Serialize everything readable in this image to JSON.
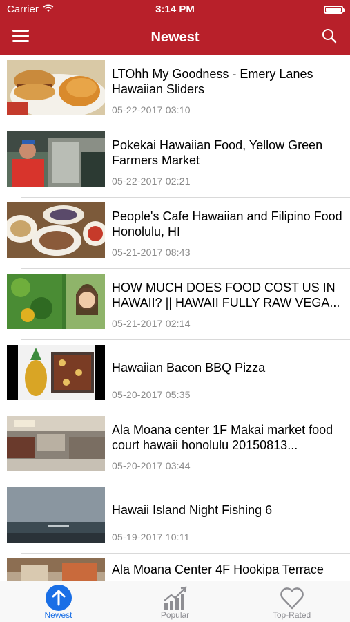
{
  "status_bar": {
    "carrier": "Carrier",
    "time": "3:14 PM",
    "icons": [
      "wifi-icon",
      "battery-icon"
    ]
  },
  "nav": {
    "title": "Newest",
    "left_icon": "hamburger-menu-icon",
    "right_icon": "search-icon"
  },
  "colors": {
    "header": "#b8202a",
    "active_tab": "#1a6fe6",
    "inactive_tab": "#8e8e93",
    "date_text": "#8a8a8a"
  },
  "items": [
    {
      "title": "LTOhh My Goodness - Emery Lanes Hawaiian Sliders",
      "date": "05-22-2017 03:10"
    },
    {
      "title": "Pokekai Hawaiian Food, Yellow Green Farmers Market",
      "date": "05-22-2017 02:21"
    },
    {
      "title": "People's Cafe Hawaiian and Filipino Food Honolulu, HI",
      "date": "05-21-2017 08:43"
    },
    {
      "title": "HOW MUCH DOES FOOD COST US IN HAWAII? || HAWAII FULLY RAW VEGA...",
      "date": "05-21-2017 02:14"
    },
    {
      "title": "Hawaiian Bacon BBQ Pizza",
      "date": "05-20-2017 05:35"
    },
    {
      "title": "Ala Moana center 1F Makai market food court hawaii honolulu 20150813...",
      "date": "05-20-2017 03:44"
    },
    {
      "title": "Hawaii Island Night Fishing 6",
      "date": "05-19-2017 10:11"
    },
    {
      "title": "Ala Moana Center 4F Hookipa Terrace",
      "date": ""
    }
  ],
  "tabs": [
    {
      "label": "Newest",
      "icon": "up-arrow-circle-icon",
      "active": true
    },
    {
      "label": "Popular",
      "icon": "trending-chart-icon",
      "active": false
    },
    {
      "label": "Top-Rated",
      "icon": "heart-icon",
      "active": false
    }
  ]
}
